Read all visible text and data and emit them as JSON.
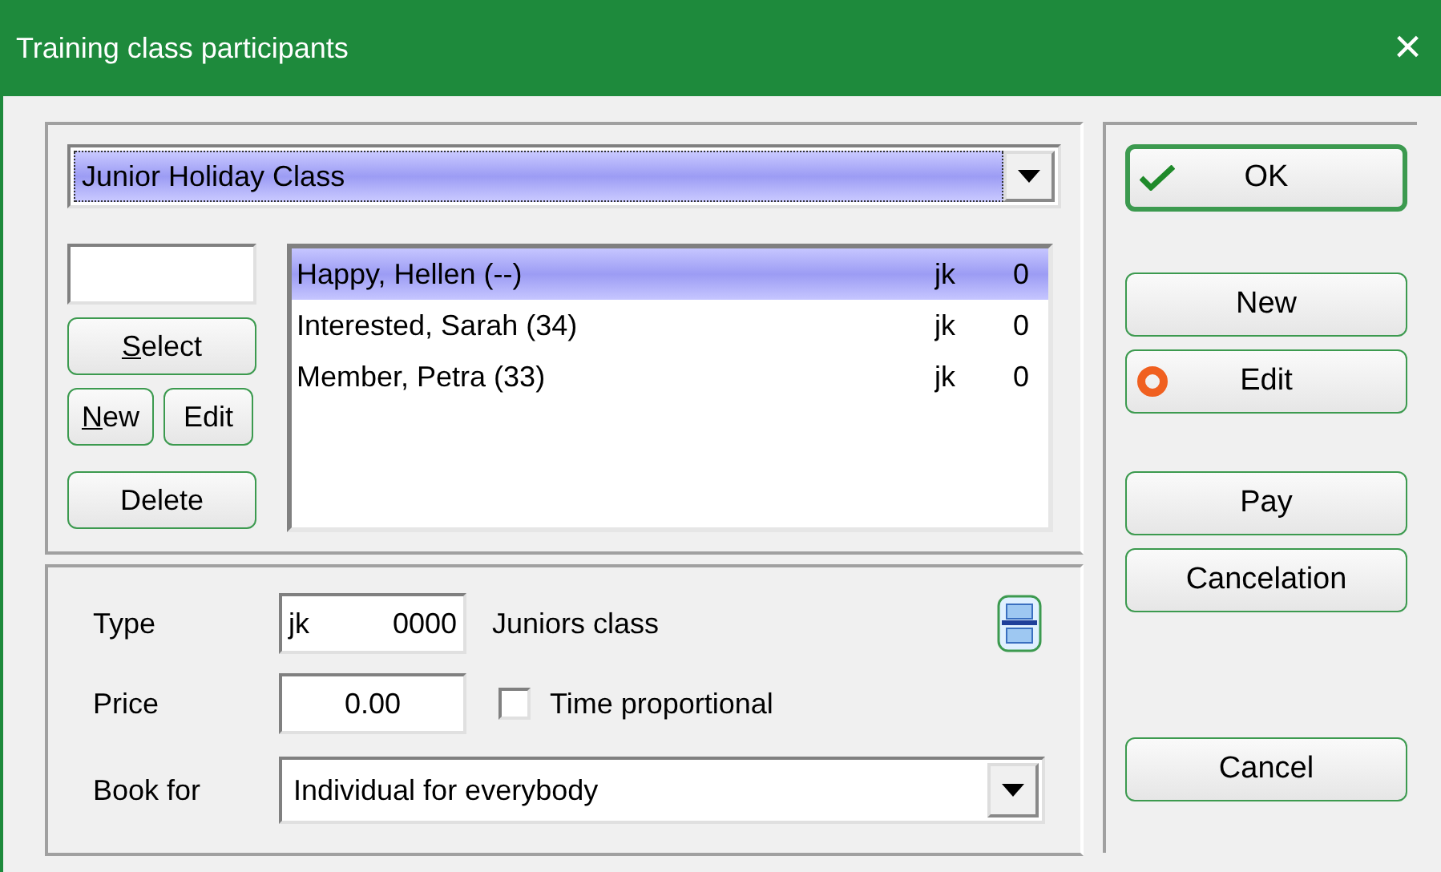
{
  "window": {
    "title": "Training class participants",
    "close": "×"
  },
  "class_select": {
    "value": "Junior Holiday Class",
    "focused": true
  },
  "left_buttons": [
    {
      "label": "Select",
      "access_key": true
    },
    {
      "label": "New",
      "access_key": true
    },
    {
      "label": "Edit",
      "access_key": false
    },
    {
      "label": "Delete",
      "access_key": false
    }
  ],
  "participants": [
    {
      "name": "Happy, Hellen (--)",
      "type": "jk",
      "code": "0",
      "selected": true
    },
    {
      "name": "Interested, Sarah (34)",
      "type": "jk",
      "code": "0",
      "selected": false
    },
    {
      "name": "Member, Petra (33)",
      "type": "jk",
      "code": "0",
      "selected": false
    }
  ],
  "details": {
    "type_label": "Type",
    "type_code": "jk",
    "type_number": "0000",
    "type_name": "Juniors class",
    "price_label": "Price",
    "price": "0.00",
    "time_proportional": {
      "label": "Time proportional",
      "checked": false
    },
    "book_for_label": "Book for",
    "book_for": "Individual for everybody"
  },
  "actions": [
    {
      "label": "OK",
      "kind": "check",
      "default": true
    },
    {
      "label": "New",
      "kind": "plain",
      "default": false
    },
    {
      "label": "Edit",
      "kind": "ring",
      "default": false
    },
    {
      "label": "Pay",
      "kind": "plain",
      "default": false
    },
    {
      "label": "Cancelation",
      "kind": "plain",
      "default": false
    },
    {
      "label": "Cancel",
      "kind": "plain",
      "default": false
    }
  ]
}
